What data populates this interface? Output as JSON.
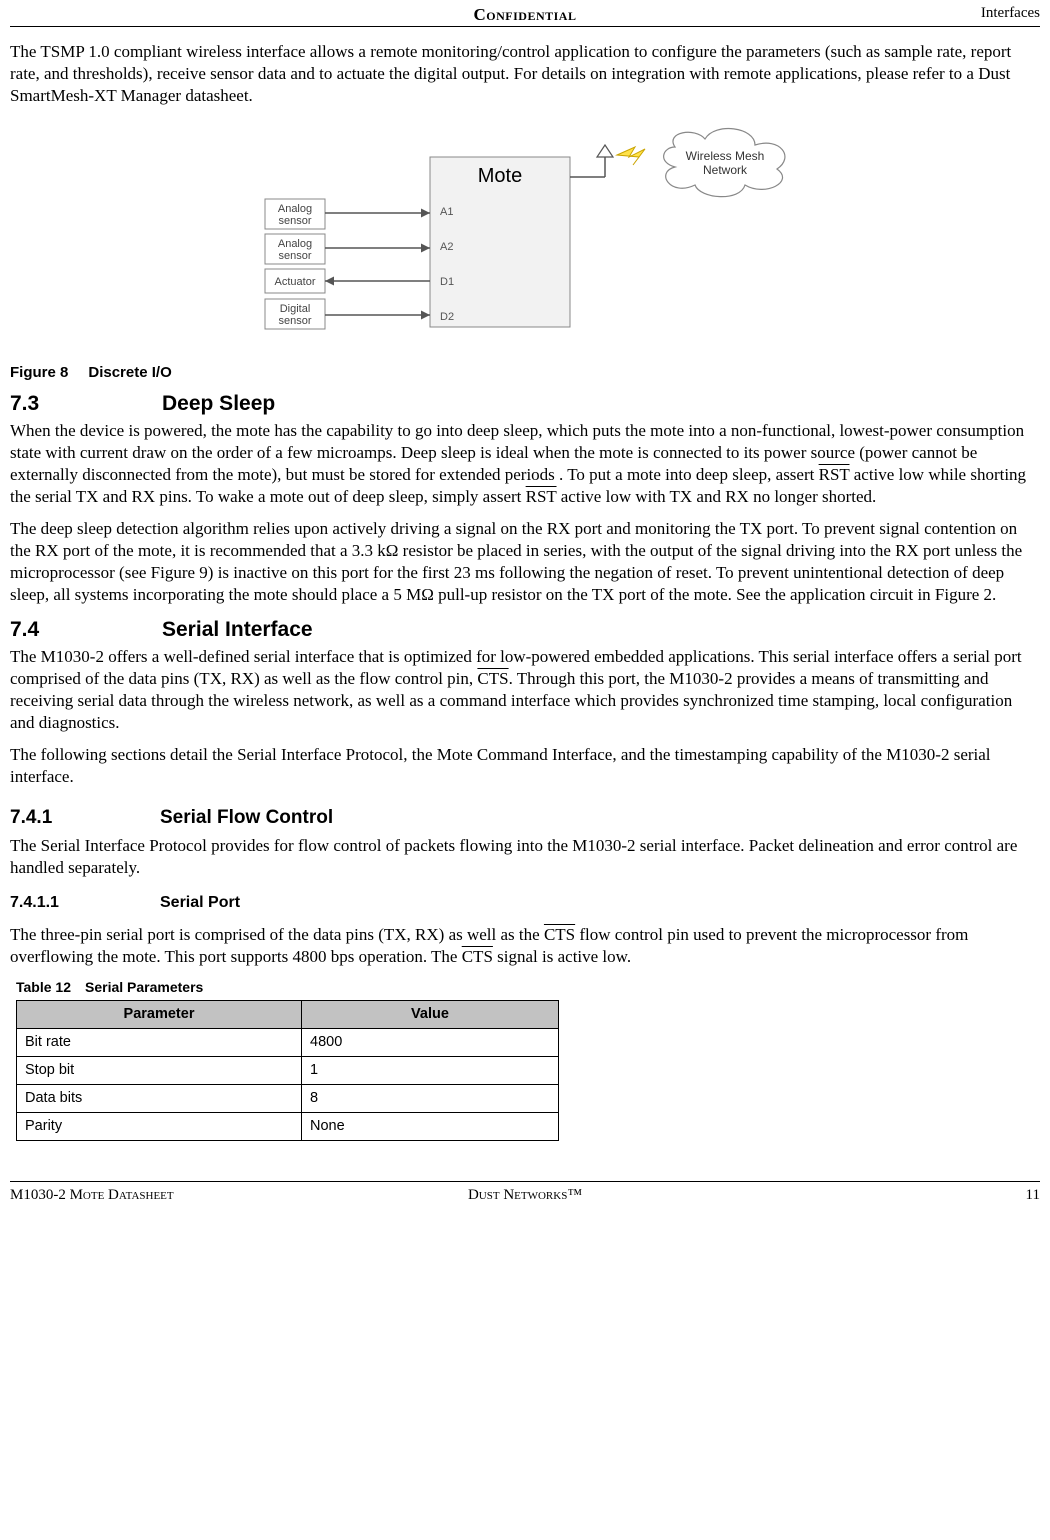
{
  "header": {
    "center": "Confidential",
    "right": "Interfaces"
  },
  "paragraphs": {
    "intro": "The TSMP 1.0 compliant wireless interface allows a remote monitoring/control application to configure the parameters (such as sample rate, report rate, and thresholds), receive sensor data and to actuate the digital output. For details on integration with remote applications, please refer to a Dust SmartMesh-XT Manager datasheet.",
    "deep1a": "When the device is powered, the mote has the capability to go into deep sleep, which puts the mote into a non-functional, lowest-power consumption state with current draw on the order of a few microamps. Deep sleep is ideal when the mote is connected to its power source (power cannot be externally disconnected from the mote), but must be stored for extended periods . To put a mote into deep sleep, assert ",
    "deep1b": " active low while shorting the serial TX and RX pins. To wake a mote out of deep sleep, simply assert ",
    "deep1c": " active low with TX and RX no longer shorted.",
    "deep2": "The deep sleep detection algorithm relies upon actively driving a signal on the RX port and monitoring the TX port. To prevent signal contention on the RX port of the mote, it is recommended that a 3.3 kΩ resistor be placed in series, with the output of the signal driving into the RX port unless the microprocessor (see Figure 9) is inactive on this port for the first 23 ms following the negation of reset. To prevent unintentional detection of deep sleep, all systems incorporating the mote should place a 5 MΩ pull-up resistor on the TX port of the mote. See the application circuit in Figure 2.",
    "serial1a": "The M1030-2 offers a well-defined serial interface that is optimized for low-powered embedded applications. This serial interface offers a serial port comprised of the data pins (TX, RX) as well as the flow control pin, ",
    "serial1b": ". Through this port, the M1030-2 provides a means of transmitting and receiving serial data through the wireless network, as well as a command interface which provides synchronized time stamping, local configuration and diagnostics.",
    "serial2": "The following sections detail the Serial Interface Protocol, the Mote Command Interface, and the timestamping capability of the M1030-2 serial interface.",
    "flow1": "The Serial Interface Protocol provides for flow control of packets flowing into the M1030-2 serial interface. Packet delineation and error control are handled separately.",
    "port1a": "The three-pin serial port is comprised of the data pins (TX, RX) as well as the ",
    "port1b": " flow control pin used to prevent the microprocessor from overflowing the mote. This port supports 4800 bps operation. The ",
    "port1c": " signal is active low."
  },
  "signals": {
    "rst": "RST",
    "cts": "CTS"
  },
  "figure8": {
    "num": "Figure 8",
    "title": "Discrete I/O"
  },
  "headings": {
    "h7_3_num": "7.3",
    "h7_3": "Deep Sleep",
    "h7_4_num": "7.4",
    "h7_4": "Serial Interface",
    "h7_4_1_num": "7.4.1",
    "h7_4_1": "Serial Flow Control",
    "h7_4_1_1_num": "7.4.1.1",
    "h7_4_1_1": "Serial Port"
  },
  "table12": {
    "num": "Table 12",
    "title": "Serial Parameters",
    "headers": {
      "param": "Parameter",
      "value": "Value"
    },
    "rows": [
      {
        "param": "Bit rate",
        "value": "4800"
      },
      {
        "param": "Stop bit",
        "value": "1"
      },
      {
        "param": "Data bits",
        "value": "8"
      },
      {
        "param": "Parity",
        "value": "None"
      }
    ]
  },
  "diagram": {
    "mote": "Mote",
    "analog_sensor": "Analog\nsensor",
    "actuator": "Actuator",
    "digital_sensor": "Digital\nsensor",
    "a1": "A1",
    "a2": "A2",
    "d1": "D1",
    "d2": "D2",
    "wireless": "Wireless Mesh\nNetwork"
  },
  "footer": {
    "left": "M1030-2 Mote Datasheet",
    "center": "Dust Networks™",
    "right": "11"
  }
}
